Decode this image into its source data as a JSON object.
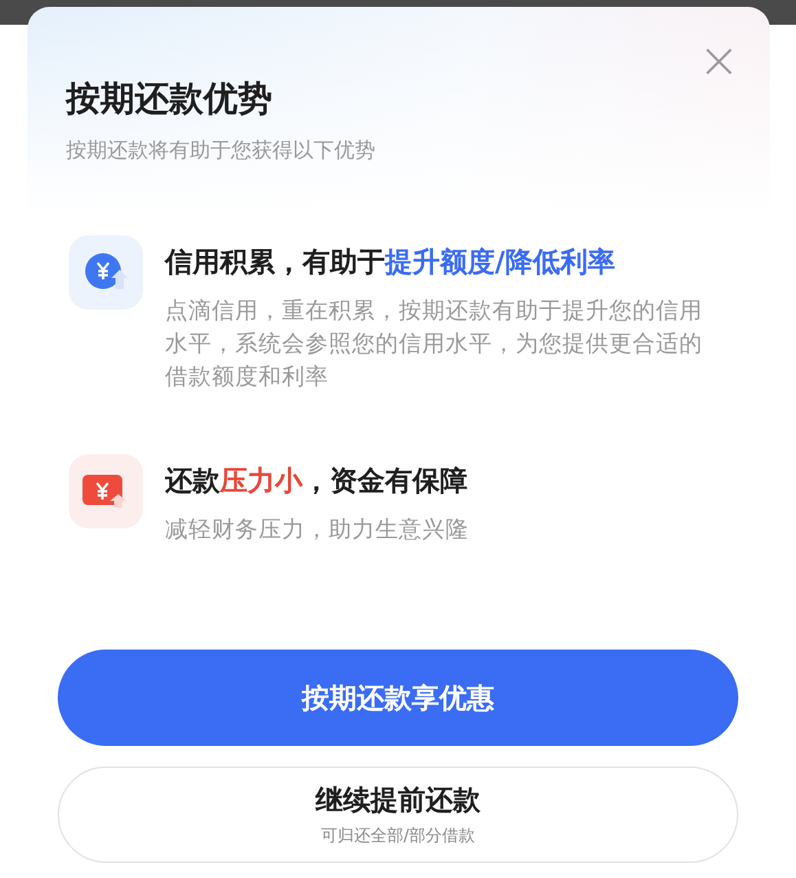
{
  "dialog": {
    "title": "按期还款优势",
    "subtitle": "按期还款将有助于您获得以下优势",
    "close": "×"
  },
  "features": [
    {
      "kind": "coin",
      "title": [
        {
          "text": "信用积累，有助于",
          "color": "#1f1f1f"
        },
        {
          "text": "提升额度/降低利率",
          "color": "#3a6cf4"
        }
      ],
      "description": "点滴信用，重在积累，按期还款有助于提升您的信用水平，系统会参照您的信用水平，为您提供更合适的借款额度和利率"
    },
    {
      "kind": "card",
      "title": [
        {
          "text": "还款",
          "color": "#1f1f1f"
        },
        {
          "text": "压力小",
          "color": "#e8473a"
        },
        {
          "text": "，资金有保障",
          "color": "#1f1f1f"
        }
      ],
      "description": "减轻财务压力，助力生意兴隆"
    }
  ],
  "buttons": [
    {
      "kind": "primary",
      "label": "按期还款享优惠"
    },
    {
      "kind": "secondary",
      "label": "继续提前还款",
      "sublabel": "可归还全部/部分借款"
    }
  ]
}
